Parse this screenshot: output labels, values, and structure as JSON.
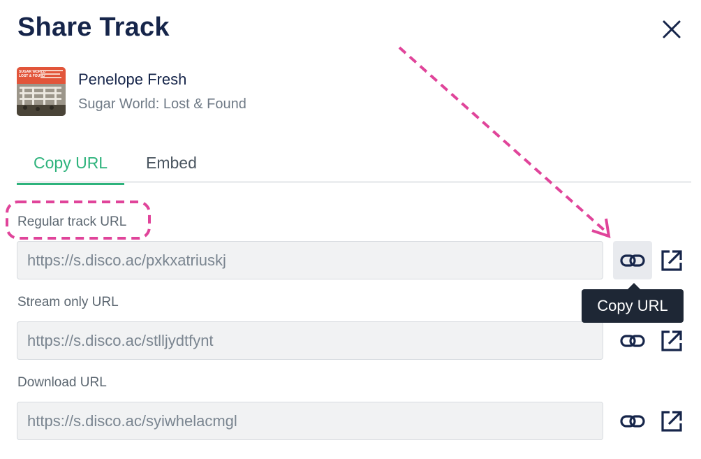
{
  "dialog": {
    "title": "Share Track",
    "close_icon": "close-icon"
  },
  "track": {
    "title": "Penelope Fresh",
    "album": "Sugar World: Lost & Found",
    "artwork_text": "SUGAR WORLD LOST & FOUND"
  },
  "tabs": [
    {
      "label": "Copy URL",
      "active": true
    },
    {
      "label": "Embed",
      "active": false
    }
  ],
  "fields": [
    {
      "label": "Regular track URL",
      "value": "https://s.disco.ac/pxkxatriuskj",
      "copy_icon": "link-icon",
      "open_icon": "external-link-icon"
    },
    {
      "label": "Stream only URL",
      "value": "https://s.disco.ac/stlljydtfynt",
      "copy_icon": "link-icon",
      "open_icon": "external-link-icon"
    },
    {
      "label": "Download URL",
      "value": "https://s.disco.ac/syiwhelacmgl",
      "copy_icon": "link-icon",
      "open_icon": "external-link-icon"
    }
  ],
  "tooltip": {
    "text": "Copy URL"
  },
  "colors": {
    "accent": "#2eb37c",
    "annotation": "#e0449a",
    "title": "#16254a",
    "tooltip_bg": "#1e2735"
  }
}
